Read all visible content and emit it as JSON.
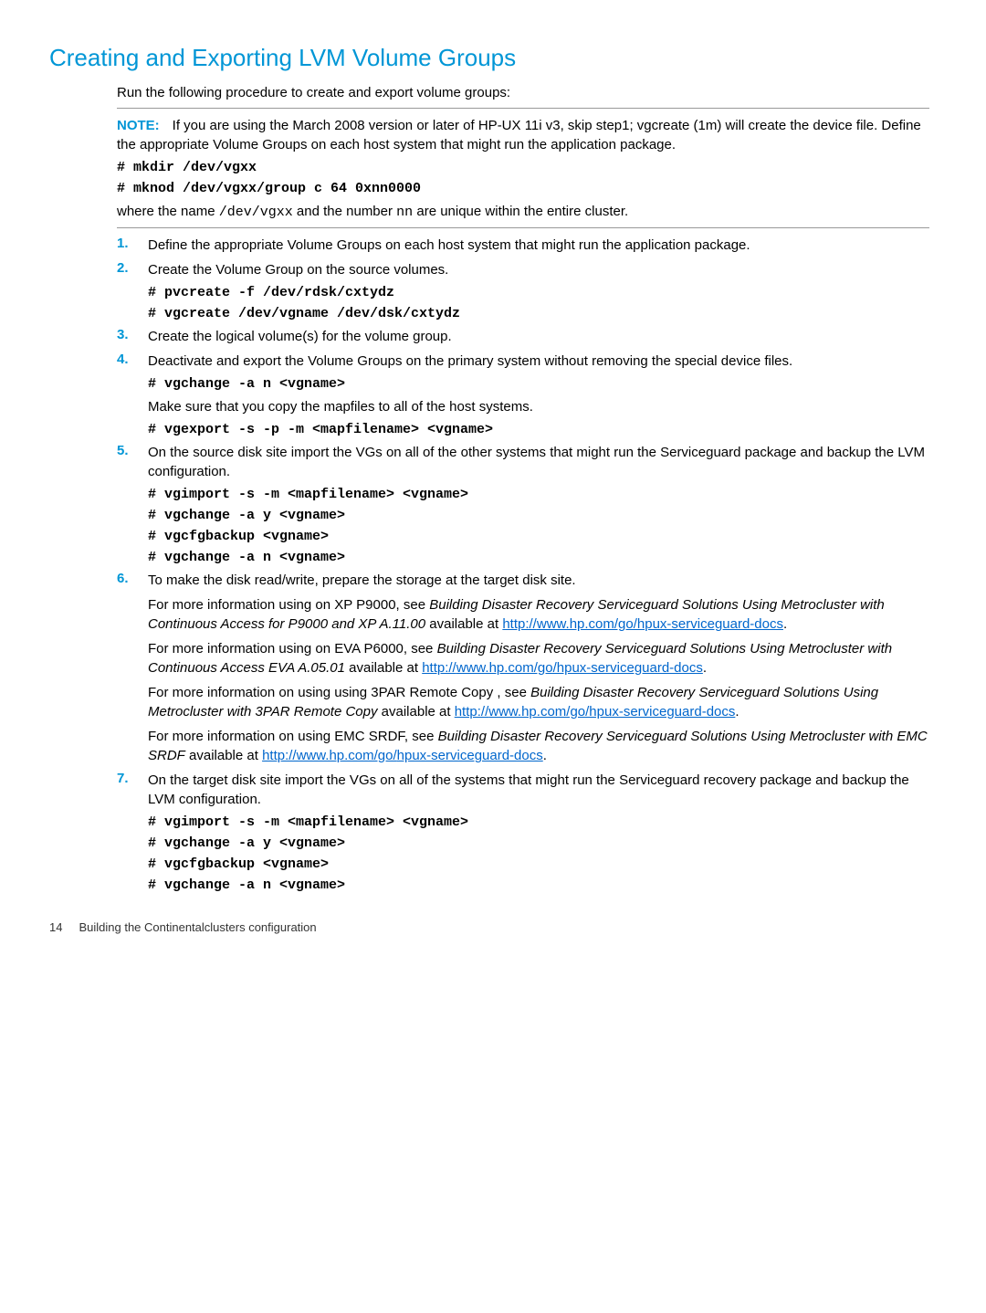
{
  "section": {
    "title": "Creating and Exporting LVM Volume Groups",
    "intro": "Run the following procedure to create and export volume groups:",
    "note_label": "NOTE:",
    "note_text": "If you are using the March 2008 version or later of HP-UX 11i v3, skip step1; vgcreate (1m) will create the device file. Define the appropriate Volume Groups on each host system that might run the application package.",
    "pre_cmds": [
      "# mkdir /dev/vgxx",
      "# mknod /dev/vgxx/group c 64 0xnn0000"
    ],
    "where_prefix": "where the name ",
    "where_code1": "/dev/vgxx",
    "where_mid": " and the number ",
    "where_code2": "nn",
    "where_suffix": " are unique within the entire cluster."
  },
  "steps": [
    {
      "text": "Define the appropriate Volume Groups on each host system that might run the application package."
    },
    {
      "text": "Create the Volume Group on the source volumes.",
      "cmds": [
        "# pvcreate -f /dev/rdsk/cxtydz",
        "# vgcreate /dev/vgname /dev/dsk/cxtydz"
      ]
    },
    {
      "text": "Create the logical volume(s) for the volume group."
    },
    {
      "text": "Deactivate and export the Volume Groups on the primary system without removing the special device files.",
      "cmds": [
        "# vgchange -a n <vgname>"
      ],
      "sub": "Make sure that you copy the mapfiles to all of the host systems.",
      "cmds2": [
        "# vgexport -s -p -m <mapfilename> <vgname>"
      ]
    },
    {
      "text": "On the source disk site import the VGs on all of the other systems that might run the Serviceguard package and backup the LVM configuration.",
      "cmds": [
        "# vgimport -s -m <mapfilename> <vgname>",
        "# vgchange -a y <vgname>",
        "# vgcfgbackup <vgname>",
        "# vgchange -a n <vgname>"
      ]
    },
    {
      "text": "To make the disk read/write, prepare the storage at the target disk site.",
      "paras": [
        {
          "pre": "For more information using on XP P9000, see ",
          "italic": "Building Disaster Recovery Serviceguard Solutions Using Metrocluster with Continuous Access for P9000 and XP A.11.00",
          "post": " available at ",
          "link1": "http://",
          "link2": "www.hp.com/go/hpux-serviceguard-docs",
          "tail": "."
        },
        {
          "pre": "For more information using on EVA P6000, see ",
          "italic": "Building Disaster Recovery Serviceguard Solutions Using Metrocluster with Continuous Access EVA A.05.01",
          "post": " available at ",
          "link1": "http://",
          "link2": "www.hp.com/go/hpux-serviceguard-docs",
          "tail": "."
        },
        {
          "pre": "For more information on using using 3PAR Remote Copy , see ",
          "italic": "Building Disaster Recovery Serviceguard Solutions Using Metrocluster with 3PAR Remote Copy ",
          "post": " available at ",
          "link1": "http://",
          "link2": "www.hp.com/go/hpux-serviceguard-docs",
          "tail": "."
        },
        {
          "pre": "For more information on using EMC SRDF, see  ",
          "italic": "Building Disaster Recovery Serviceguard Solutions Using Metrocluster with EMC SRDF",
          "post": " available at ",
          "link1": "http://www.hp.com/go/",
          "link2": "hpux-serviceguard-docs",
          "tail": "."
        }
      ]
    },
    {
      "text": "On the target disk site import the VGs on all of the systems that might run the Serviceguard recovery package and backup the LVM configuration.",
      "cmds": [
        "# vgimport -s -m <mapfilename> <vgname>",
        "# vgchange -a y <vgname>",
        "# vgcfgbackup <vgname>",
        "# vgchange -a n <vgname>"
      ]
    }
  ],
  "footer": {
    "page_number": "14",
    "chapter": "Building the Continentalclusters configuration"
  }
}
